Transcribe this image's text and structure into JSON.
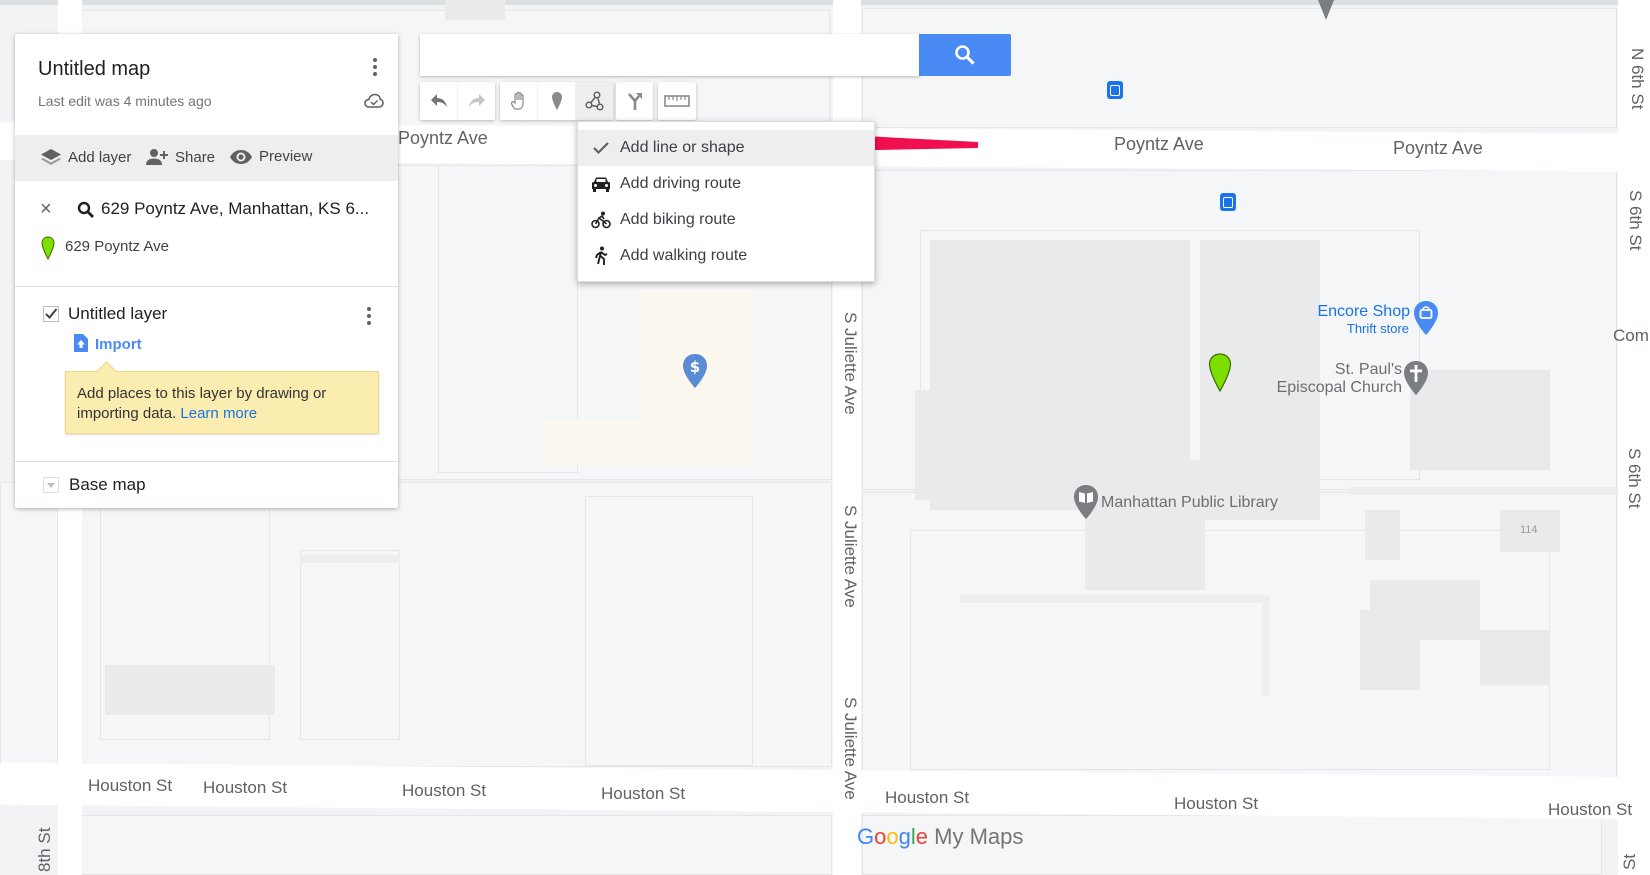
{
  "panel": {
    "title": "Untitled map",
    "last_edit": "Last edit was 4 minutes ago",
    "actions": [
      {
        "label": "Add layer",
        "icon": "layers-icon"
      },
      {
        "label": "Share",
        "icon": "add-person-icon"
      },
      {
        "label": "Preview",
        "icon": "eye-icon"
      }
    ],
    "search_result": {
      "query": "629 Poyntz Ave, Manhattan, KS 6...",
      "place": "629 Poyntz Ave"
    },
    "layer": {
      "name": "Untitled layer",
      "checked": true,
      "import_label": "Import",
      "tip_text": "Add places to this layer by drawing or importing data.",
      "tip_link": "Learn more"
    },
    "base_map": "Base map"
  },
  "search": {
    "value": "",
    "placeholder": ""
  },
  "toolbar": {
    "buttons": [
      "undo-icon",
      "redo-icon",
      "hand-icon",
      "marker-icon",
      "draw-line-icon",
      "directions-icon",
      "ruler-icon"
    ],
    "active": "draw-line-icon"
  },
  "draw_menu": {
    "items": [
      {
        "label": "Add line or shape",
        "icon": "check-icon",
        "selected": true
      },
      {
        "label": "Add driving route",
        "icon": "car-icon",
        "selected": false
      },
      {
        "label": "Add biking route",
        "icon": "bike-icon",
        "selected": false
      },
      {
        "label": "Add walking route",
        "icon": "walk-icon",
        "selected": false
      }
    ]
  },
  "annotation": {
    "type": "arrow",
    "color": "#f0104f",
    "points_to": "Add line or shape"
  },
  "map": {
    "streets": {
      "poyntz": [
        "Poyntz Ave",
        "Poyntz Ave",
        "Poyntz Ave"
      ],
      "houston": [
        "Houston St",
        "Houston St",
        "Houston St",
        "Houston St",
        "Houston St",
        "Houston St",
        "Houston St"
      ],
      "juliette": [
        "S Juliette Ave",
        "S Juliette Ave",
        "S Juliette Ave"
      ],
      "sixth": [
        "N 6th St",
        "S 6th St",
        "S 6th St"
      ],
      "eighth": "8th St",
      "partial_right": "Com",
      "partial_bottom": "St"
    },
    "pois": {
      "encore_name": "Encore Shop",
      "encore_type": "Thrift store",
      "church_line1": "St. Paul's",
      "church_line2": "Episcopal Church",
      "library": "Manhattan Public Library",
      "building_number": "114"
    },
    "branding": {
      "google": "Google",
      "product": "My Maps"
    },
    "colors": {
      "marker": "#7cdf00",
      "accent": "#4a8af4",
      "poi_blue": "#1a73e8"
    }
  }
}
